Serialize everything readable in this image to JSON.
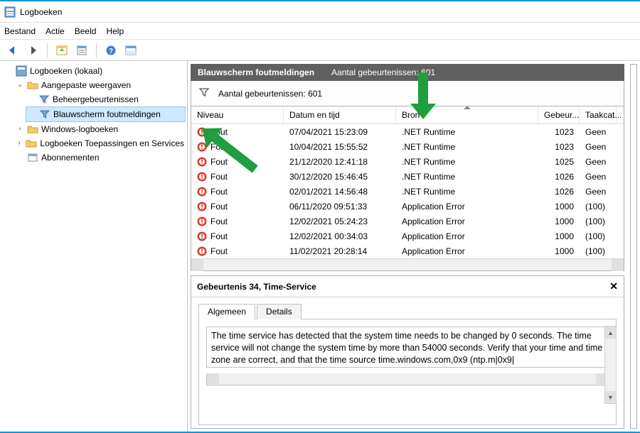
{
  "window": {
    "title": "Logboeken"
  },
  "menu": {
    "bestand": "Bestand",
    "actie": "Actie",
    "beeld": "Beeld",
    "help": "Help"
  },
  "tree": {
    "root": "Logboeken (lokaal)",
    "custom_views": "Aangepaste weergaven",
    "admin_events": "Beheergebeurtenissen",
    "bluescreen": "Blauwscherm foutmeldingen",
    "windows_logs": "Windows-logboeken",
    "app_service_logs": "Logboeken Toepassingen en Services",
    "subscriptions": "Abonnementen"
  },
  "view": {
    "title": "Blauwscherm foutmeldingen",
    "count_label": "Aantal gebeurtenissen: 601",
    "filter_label": "Aantal gebeurtenissen: 601"
  },
  "columns": {
    "niveau": "Niveau",
    "datum": "Datum en tijd",
    "bron": "Bron",
    "gebeur": "Gebeur...",
    "taak": "Taakcat..."
  },
  "rows": [
    {
      "level": "Fout",
      "date": "07/04/2021 15:23:09",
      "source": ".NET Runtime",
      "id": "1023",
      "task": "Geen"
    },
    {
      "level": "Fout",
      "date": "10/04/2021 15:55:52",
      "source": ".NET Runtime",
      "id": "1023",
      "task": "Geen"
    },
    {
      "level": "Fout",
      "date": "21/12/2020 12:41:18",
      "source": ".NET Runtime",
      "id": "1025",
      "task": "Geen"
    },
    {
      "level": "Fout",
      "date": "30/12/2020 15:46:45",
      "source": ".NET Runtime",
      "id": "1026",
      "task": "Geen"
    },
    {
      "level": "Fout",
      "date": "02/01/2021 14:56:48",
      "source": ".NET Runtime",
      "id": "1026",
      "task": "Geen"
    },
    {
      "level": "Fout",
      "date": "06/11/2020 09:51:33",
      "source": "Application Error",
      "id": "1000",
      "task": "(100)"
    },
    {
      "level": "Fout",
      "date": "12/02/2021 05:24:23",
      "source": "Application Error",
      "id": "1000",
      "task": "(100)"
    },
    {
      "level": "Fout",
      "date": "12/02/2021 00:34:03",
      "source": "Application Error",
      "id": "1000",
      "task": "(100)"
    },
    {
      "level": "Fout",
      "date": "11/02/2021 20:28:14",
      "source": "Application Error",
      "id": "1000",
      "task": "(100)"
    }
  ],
  "detail": {
    "header": "Gebeurtenis 34, Time-Service",
    "tab_general": "Algemeen",
    "tab_details": "Details",
    "description": "The time service has detected that the system time needs to be  changed by 0 seconds. The time service will not change the system time by more than 54000 seconds. Verify that your time and time zone are correct, and that the time source time.windows.com,0x9 (ntp.m|0x9|"
  }
}
